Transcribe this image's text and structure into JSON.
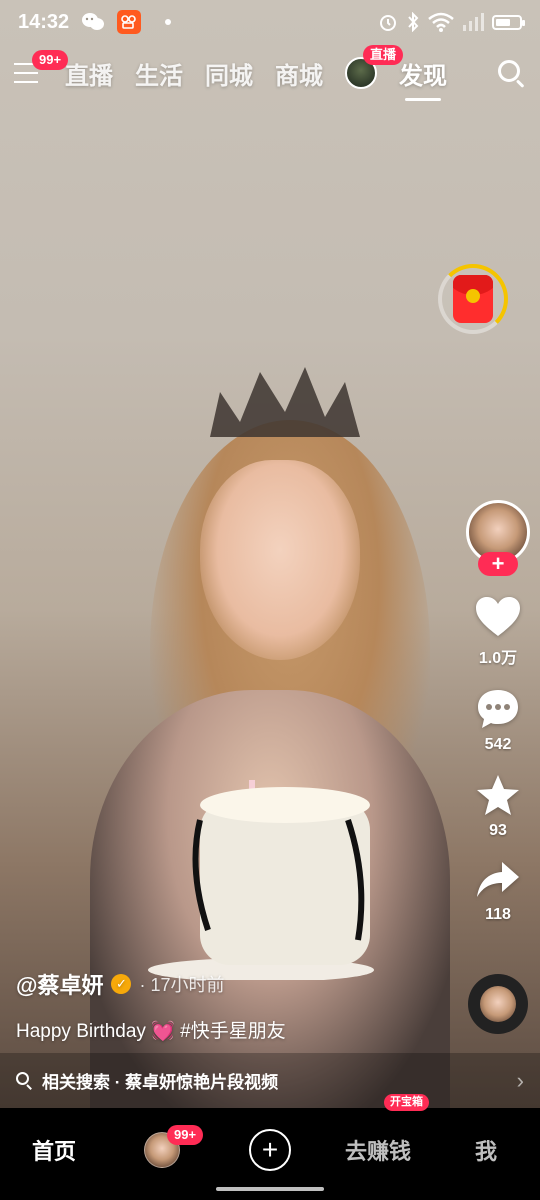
{
  "status_bar": {
    "time": "14:32",
    "app_icons": [
      "wechat-icon",
      "kuaishou-icon"
    ],
    "indicators": [
      "alarm-icon",
      "bluetooth-icon",
      "wifi-icon",
      "signal-icon",
      "battery-icon"
    ],
    "battery_level": 0.65
  },
  "top_nav": {
    "menu_badge": "99+",
    "tabs": [
      {
        "label": "直播",
        "active": false
      },
      {
        "label": "生活",
        "active": false
      },
      {
        "label": "同城",
        "active": false
      },
      {
        "label": "商城",
        "active": false
      }
    ],
    "live_badge": "直播",
    "active_tab": "发现"
  },
  "right_rail": {
    "follow_label": "+",
    "likes": "1.0万",
    "comments": "542",
    "favorites": "93",
    "shares": "118"
  },
  "caption": {
    "author": "@蔡卓妍",
    "time_ago": "· 17小时前",
    "text": "Happy Birthday",
    "emoji": "💓",
    "hashtag": "#快手星朋友"
  },
  "related_search": {
    "label": "相关搜索 · 蔡卓妍惊艳片段视频"
  },
  "bottom_tabs": {
    "home": "首页",
    "follow_badge": "99+",
    "create": "+",
    "earn": "去赚钱",
    "earn_badge": "开宝箱",
    "me": "我"
  },
  "colors": {
    "accent": "#ff2c55",
    "verified": "#f7a90a",
    "red_packet": "#ff2d2d",
    "timer_ring": "#f5c400"
  }
}
